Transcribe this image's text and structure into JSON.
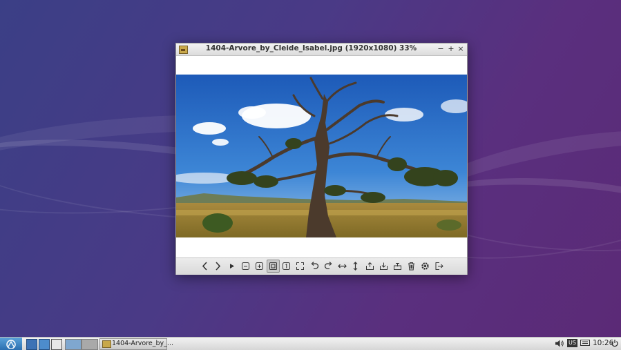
{
  "window": {
    "title": "1404-Arvore_by_Cleide_Isabel.jpg (1920x1080) 33%",
    "controls": {
      "minimize": "−",
      "maximize": "+",
      "close": "×"
    }
  },
  "toolbar": {
    "buttons": [
      {
        "name": "previous-icon"
      },
      {
        "name": "next-icon"
      },
      {
        "name": "slideshow-icon"
      },
      {
        "name": "zoom-out-icon"
      },
      {
        "name": "zoom-in-icon"
      },
      {
        "name": "zoom-fit-icon",
        "active": true
      },
      {
        "name": "original-size-icon"
      },
      {
        "name": "fullscreen-icon"
      },
      {
        "name": "rotate-left-icon"
      },
      {
        "name": "rotate-right-icon"
      },
      {
        "name": "flip-horizontal-icon"
      },
      {
        "name": "flip-vertical-icon"
      },
      {
        "name": "open-icon"
      },
      {
        "name": "save-icon"
      },
      {
        "name": "save-as-icon"
      },
      {
        "name": "delete-icon"
      },
      {
        "name": "preferences-icon"
      },
      {
        "name": "quit-icon"
      }
    ]
  },
  "taskbar": {
    "task_label": "1404-Arvore_by_...",
    "keyboard_layout": "US",
    "clock": "10:26"
  }
}
